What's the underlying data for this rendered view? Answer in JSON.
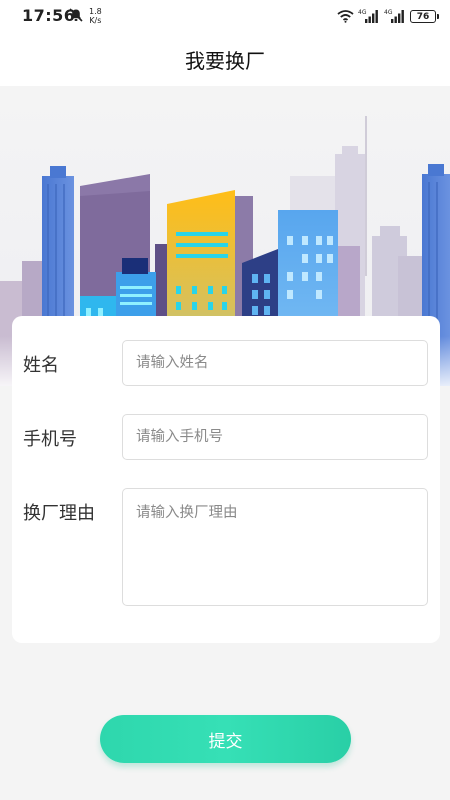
{
  "status_bar": {
    "time": "17:56",
    "net_speed_value": "1.8",
    "net_speed_unit": "K/s",
    "signal_1_label": "4G",
    "signal_2_label": "4G",
    "battery_level": "76"
  },
  "header": {
    "title": "我要换厂"
  },
  "form": {
    "name_label": "姓名",
    "name_placeholder": "请输入姓名",
    "phone_label": "手机号",
    "phone_placeholder": "请输入手机号",
    "reason_label": "换厂理由",
    "reason_placeholder": "请输入换厂理由"
  },
  "submit_label": "提交",
  "colors": {
    "accent": "#33dbb2",
    "page_background": "#f4f4f4",
    "card_background": "#ffffff"
  }
}
